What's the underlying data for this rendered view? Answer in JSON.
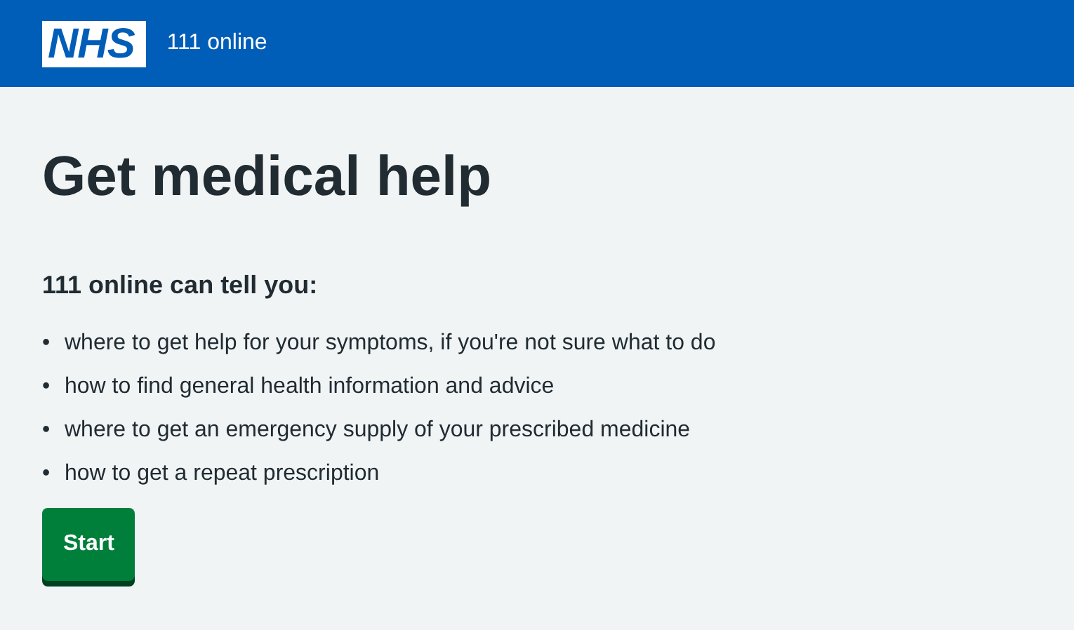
{
  "header": {
    "logo": "NHS",
    "service": "111 online"
  },
  "title": "Get medical help",
  "intro": "111 online can tell you:",
  "items": [
    {
      "marker": "•",
      "text": "where to get help for your symptoms, if you're not sure what to do"
    },
    {
      "marker": "•",
      "text": "how to find general health information and advice"
    },
    {
      "marker": "•",
      "text": "where to get an emergency supply of your prescribed medicine"
    },
    {
      "marker": "•",
      "text": "how to get a repeat prescription"
    }
  ],
  "button": "Start"
}
